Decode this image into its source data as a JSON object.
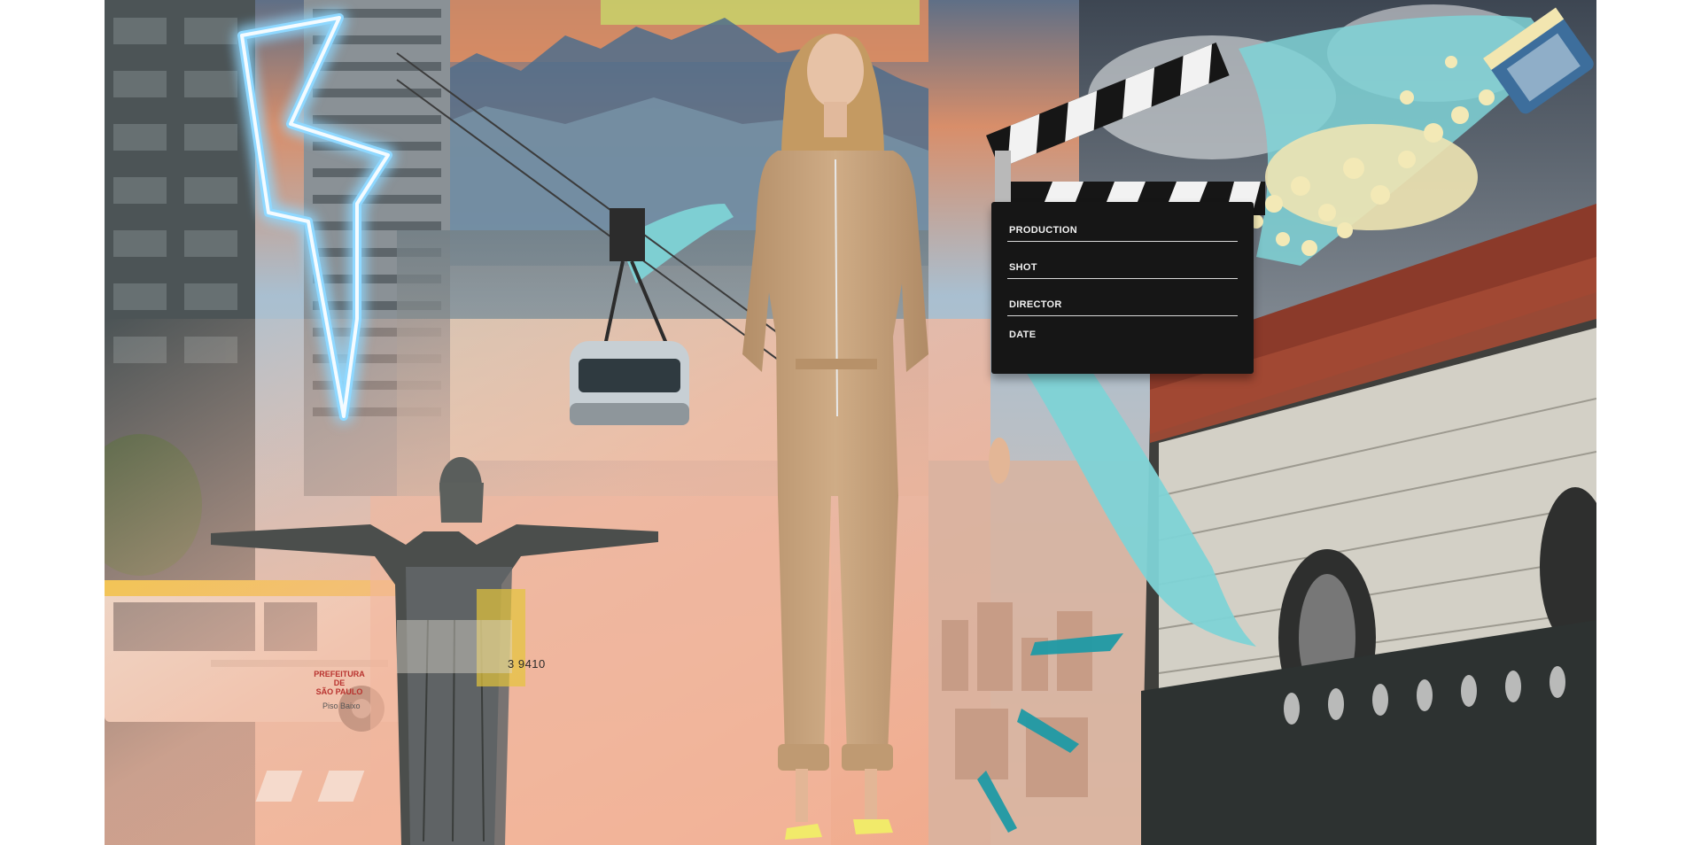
{
  "clapperboard": {
    "rows": [
      {
        "label": "PRODUCTION"
      },
      {
        "label": "SHOT"
      },
      {
        "label": "DIRECTOR"
      },
      {
        "label": "DATE"
      }
    ]
  },
  "bus": {
    "number": "3 9410",
    "sign_line1": "PREFEITURA DE",
    "sign_line2": "SÃO PAULO",
    "sign_sub": "Piso Baixo"
  },
  "colors": {
    "sky_orange": "#f2a57c",
    "peach_gradient": "#f4b9a0",
    "turquoise_brush": "#7fd3d6",
    "neon_blue": "#8fd8ff",
    "jumpsuit_tan": "#c6a27c",
    "building_red": "#8b3a2a",
    "slate_black": "#161616"
  }
}
